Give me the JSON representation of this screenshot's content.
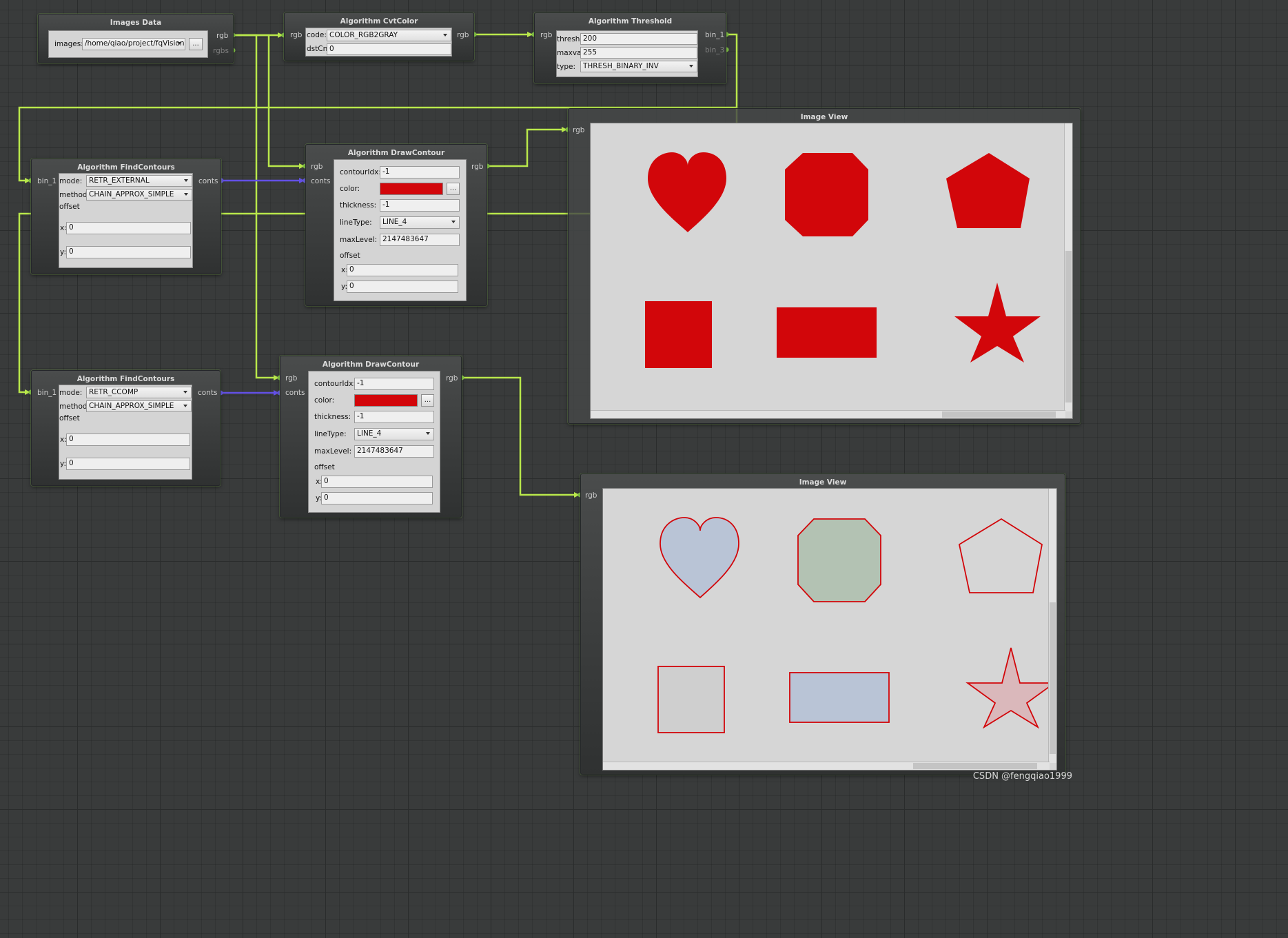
{
  "colors": {
    "wire": "#b9e84b",
    "wire_contour": "#6350e6",
    "port": "#8bd14a",
    "fill_red": "#d2060a"
  },
  "images_data": {
    "title": "Images Data",
    "images_label": "images:",
    "images_value": "/home/qiao/project/fqVision",
    "browse": "...",
    "out_rgb": "rgb",
    "out_rgbs": "rgbs"
  },
  "cvtcolor": {
    "title": "Algorithm CvtColor",
    "in_rgb": "rgb",
    "out_rgb": "rgb",
    "code_label": "code:",
    "code_value": "COLOR_RGB2GRAY",
    "dstcn_label": "dstCn:",
    "dstcn_value": "0"
  },
  "threshold": {
    "title": "Algorithm Threshold",
    "in_rgb": "rgb",
    "out_bin1": "bin_1",
    "out_bin3": "bin_3",
    "thresh_label": "thresh:",
    "thresh_value": "200",
    "maxval_label": "maxval:",
    "maxval_value": "255",
    "type_label": "type:",
    "type_value": "THRESH_BINARY_INV"
  },
  "findcontours_1": {
    "title": "Algorithm FindContours",
    "in_bin1": "bin_1",
    "out_conts": "conts",
    "mode_label": "mode:",
    "mode_value": "RETR_EXTERNAL",
    "method_label": "method:",
    "method_value": "CHAIN_APPROX_SIMPLE",
    "offset_label": "offset",
    "x_label": "x:",
    "x_value": "0",
    "y_label": "y:",
    "y_value": "0"
  },
  "findcontours_2": {
    "title": "Algorithm FindContours",
    "in_bin1": "bin_1",
    "out_conts": "conts",
    "mode_label": "mode:",
    "mode_value": "RETR_CCOMP",
    "method_label": "method:",
    "method_value": "CHAIN_APPROX_SIMPLE",
    "offset_label": "offset",
    "x_label": "x:",
    "x_value": "0",
    "y_label": "y:",
    "y_value": "0"
  },
  "drawcontour_1": {
    "title": "Algorithm DrawContour",
    "in_rgb": "rgb",
    "in_conts": "conts",
    "out_rgb": "rgb",
    "idx_label": "contourIdx:",
    "idx_value": "-1",
    "color_label": "color:",
    "color_value": "#d2060a",
    "color_btn": "...",
    "thickness_label": "thickness:",
    "thickness_value": "-1",
    "linetype_label": "lineType:",
    "linetype_value": "LINE_4",
    "maxlevel_label": "maxLevel:",
    "maxlevel_value": "2147483647",
    "offset_label": "offset",
    "x_label": "x:",
    "x_value": "0",
    "y_label": "y:",
    "y_value": "0"
  },
  "drawcontour_2": {
    "title": "Algorithm DrawContour",
    "in_rgb": "rgb",
    "in_conts": "conts",
    "out_rgb": "rgb",
    "idx_label": "contourIdx:",
    "idx_value": "-1",
    "color_label": "color:",
    "color_value": "#d2060a",
    "color_btn": "...",
    "thickness_label": "thickness:",
    "thickness_value": "-1",
    "linetype_label": "lineType:",
    "linetype_value": "LINE_4",
    "maxlevel_label": "maxLevel:",
    "maxlevel_value": "2147483647",
    "offset_label": "offset",
    "x_label": "x:",
    "x_value": "0",
    "y_label": "y:",
    "y_value": "0"
  },
  "imageview_1": {
    "title": "Image View",
    "in_rgb": "rgb",
    "shapes": [
      "heart",
      "octagon",
      "pentagon",
      "square",
      "rectangle",
      "star"
    ],
    "style": "filled red"
  },
  "imageview_2": {
    "title": "Image View",
    "in_rgb": "rgb",
    "shapes": [
      "heart",
      "octagon",
      "pentagon",
      "square",
      "rectangle",
      "star"
    ],
    "style": "red outline"
  },
  "watermark": "CSDN @fengqiao1999"
}
